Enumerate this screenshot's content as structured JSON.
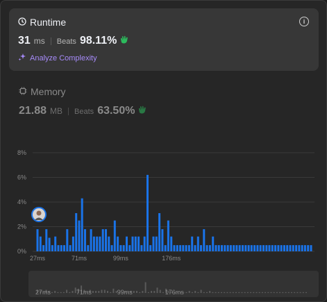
{
  "runtime": {
    "title": "Runtime",
    "value": "31",
    "unit": "ms",
    "beats_label": "Beats",
    "beats_value": "98.11%",
    "analyze_label": "Analyze Complexity"
  },
  "memory": {
    "title": "Memory",
    "value": "21.88",
    "unit": "MB",
    "beats_label": "Beats",
    "beats_value": "63.50%"
  },
  "colors": {
    "bar": "#1a73e8",
    "accent_green": "#2cbb5d",
    "analyze_purple": "#a78bfa"
  },
  "chart_data": {
    "type": "bar",
    "ylim": [
      0,
      8
    ],
    "y_ticks": [
      "8%",
      "6%",
      "4%",
      "2%",
      "0%"
    ],
    "x_tick_labels": [
      "27ms",
      "71ms",
      "99ms",
      "176ms"
    ],
    "x_tick_positions": [
      0,
      14,
      28,
      45
    ],
    "highlight_index": 0,
    "values": [
      1.8,
      1.2,
      0.5,
      1.8,
      1.1,
      0.5,
      1.2,
      0.5,
      0.5,
      0.5,
      1.8,
      0.5,
      1.2,
      3.1,
      2.5,
      4.3,
      1.8,
      0.5,
      1.8,
      1.2,
      1.2,
      1.2,
      1.8,
      1.8,
      1.2,
      0.5,
      2.5,
      1.2,
      0.5,
      0.5,
      1.2,
      0.5,
      1.2,
      1.2,
      1.2,
      0.5,
      1.2,
      6.2,
      0.5,
      1.2,
      1.2,
      3.1,
      1.8,
      0.5,
      2.5,
      1.2,
      0.5,
      0.5,
      0.5,
      0.5,
      0.5,
      0.5,
      1.2,
      0.5,
      1.2,
      0.5,
      1.8,
      0.5,
      0.5,
      1.2,
      0.5,
      0.5,
      0.5,
      0.5,
      0.5,
      0.5,
      0.5,
      0.5,
      0.5,
      0.5,
      0.5,
      0.5,
      0.5,
      0.5,
      0.5,
      0.5,
      0.5,
      0.5,
      0.5,
      0.5,
      0.5,
      0.5,
      0.5,
      0.5,
      0.5,
      0.5,
      0.5,
      0.5,
      0.5,
      0.5,
      0.5,
      0.5,
      0.5
    ]
  },
  "minimap": {
    "x_tick_labels": [
      "27ms",
      "71ms",
      "99ms",
      "176ms"
    ]
  }
}
